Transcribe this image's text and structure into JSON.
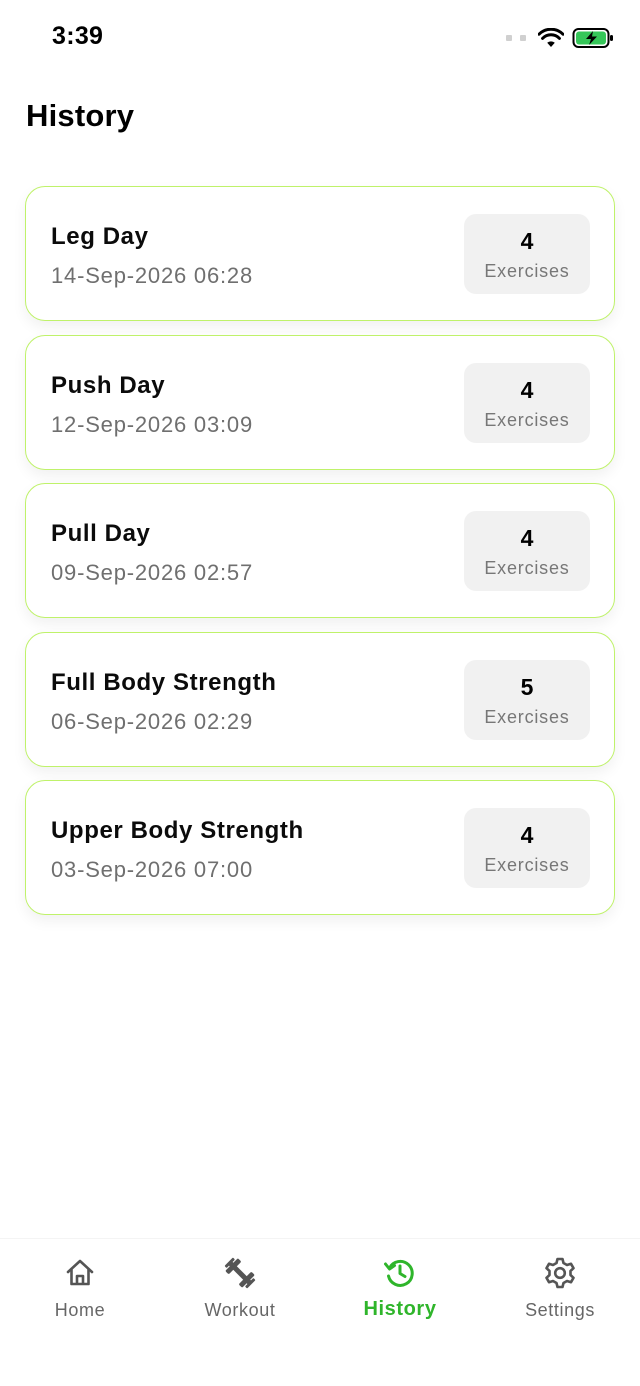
{
  "status": {
    "time": "3:39"
  },
  "page": {
    "title": "History"
  },
  "workouts": [
    {
      "name": "Leg Day",
      "date": "14-Sep-2026 06:28",
      "count": "4",
      "count_label": "Exercises"
    },
    {
      "name": "Push Day",
      "date": "12-Sep-2026 03:09",
      "count": "4",
      "count_label": "Exercises"
    },
    {
      "name": "Pull Day",
      "date": "09-Sep-2026 02:57",
      "count": "4",
      "count_label": "Exercises"
    },
    {
      "name": "Full Body Strength",
      "date": "06-Sep-2026 02:29",
      "count": "5",
      "count_label": "Exercises"
    },
    {
      "name": "Upper Body Strength",
      "date": "03-Sep-2026 07:00",
      "count": "4",
      "count_label": "Exercises"
    }
  ],
  "tabs": [
    {
      "label": "Home",
      "icon": "home-icon",
      "active": false
    },
    {
      "label": "Workout",
      "icon": "dumbbell-icon",
      "active": false
    },
    {
      "label": "History",
      "icon": "history-icon",
      "active": true
    },
    {
      "label": "Settings",
      "icon": "gear-icon",
      "active": false
    }
  ],
  "colors": {
    "accent": "#2fb52b",
    "card_border": "#bff26a",
    "battery": "#35c759"
  }
}
